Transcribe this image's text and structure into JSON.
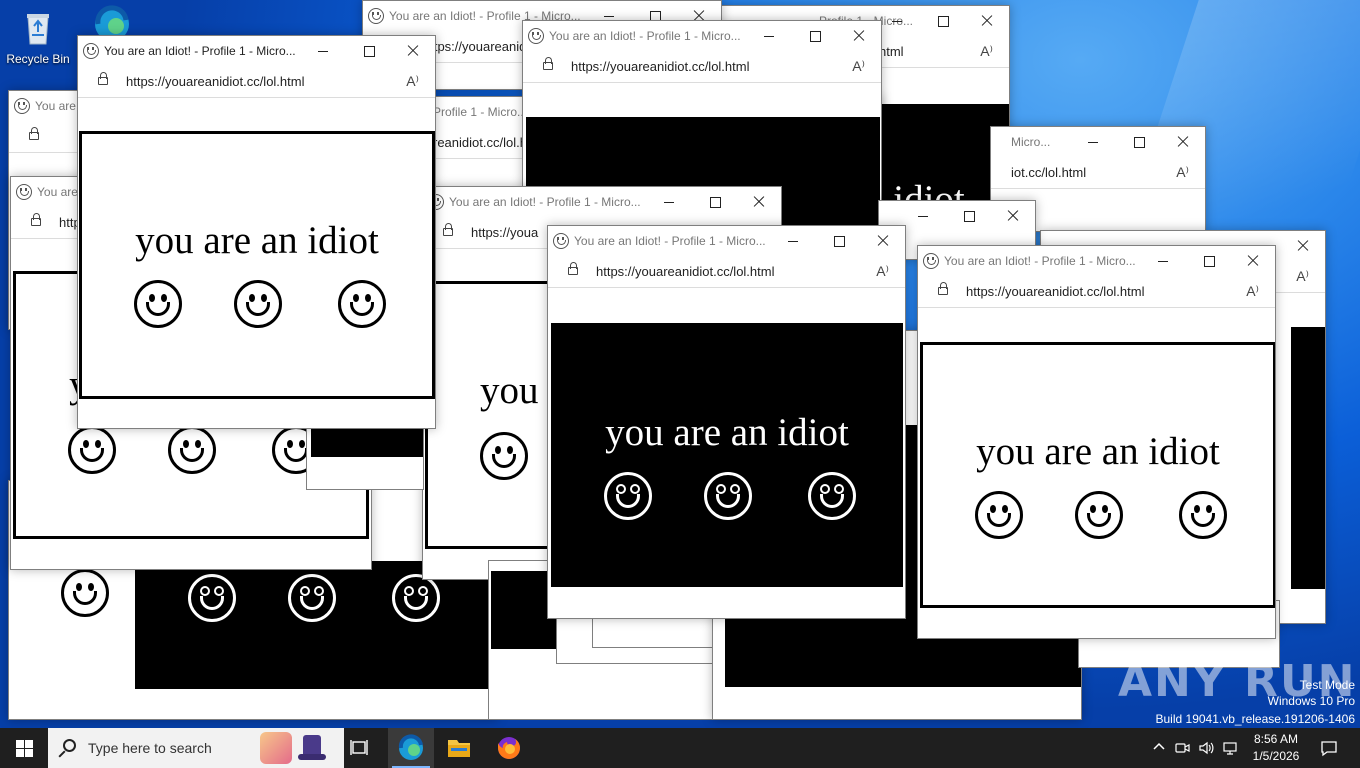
{
  "desktop": {
    "icons": [
      {
        "label": "Recycle Bin",
        "icon": "recycle-bin-icon"
      },
      {
        "label": "",
        "icon": "edge-icon"
      }
    ],
    "watermark": {
      "line1": "Test Mode",
      "line2": "Windows 10 Pro",
      "line3": "Build 19041.vb_release.191206-1406",
      "logo_text": "ANY RUN"
    }
  },
  "popup": {
    "title": "You are an Idiot! - Profile 1 - Micro...",
    "title_lower": "You are an Idiot! - Profile 1 - Micro...",
    "url": "https://youareanidiot.cc/lol.html",
    "url_partial_1": "https://youareanid",
    "url_partial_2": "reanidiot.cc/lol.html",
    "url_partial_3": "iot.cc/lol.html",
    "url_partial_4": "https://youa",
    "url_partial_5": "html",
    "title_partial_1": "You are a",
    "title_partial_2": "Profile 1 - Micro...",
    "title_partial_3": "Micro...",
    "message": "you are an idiot",
    "message_partial_1": "you",
    "message_partial_2": "idiot",
    "read_aloud": "A⁾",
    "colors": {
      "white_stage": "#ffffff",
      "black_stage": "#000000"
    }
  },
  "taskbar": {
    "search_placeholder": "Type here to search",
    "apps": [
      {
        "name": "task-view-icon",
        "active": false
      },
      {
        "name": "edge-icon",
        "active": true
      },
      {
        "name": "file-explorer-icon",
        "active": false
      },
      {
        "name": "firefox-icon",
        "active": false
      }
    ],
    "clock": {
      "time": "8:56 AM",
      "date": "1/5/2026"
    }
  }
}
